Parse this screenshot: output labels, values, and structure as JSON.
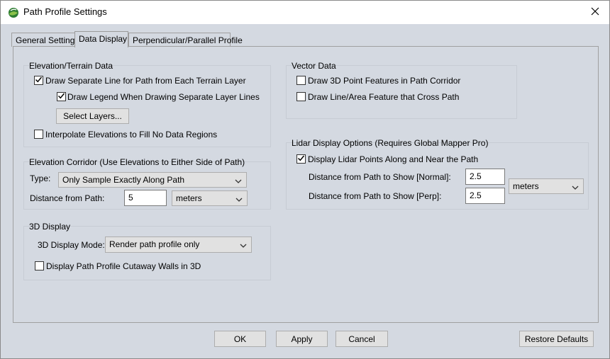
{
  "window": {
    "title": "Path Profile Settings"
  },
  "tabs": [
    {
      "label": "General Settings"
    },
    {
      "label": "Data Display"
    },
    {
      "label": "Perpendicular/Parallel Profile"
    }
  ],
  "elevation_terrain": {
    "title": "Elevation/Terrain Data",
    "draw_separate_line": {
      "label": "Draw Separate Line for Path from Each Terrain Layer",
      "checked": true
    },
    "draw_legend": {
      "label": "Draw Legend When Drawing Separate Layer Lines",
      "checked": true
    },
    "select_layers_label": "Select Layers...",
    "interpolate": {
      "label": "Interpolate Elevations to Fill No Data Regions",
      "checked": false
    }
  },
  "elevation_corridor": {
    "title": "Elevation Corridor (Use Elevations to Either Side of Path)",
    "type_label": "Type:",
    "type_value": "Only Sample Exactly Along Path",
    "distance_label": "Distance from Path:",
    "distance_value": "5",
    "distance_unit": "meters"
  },
  "display_3d": {
    "title": "3D Display",
    "mode_label": "3D Display Mode:",
    "mode_value": "Render path profile only",
    "cutaway": {
      "label": "Display Path Profile Cutaway Walls in 3D",
      "checked": false
    }
  },
  "vector_data": {
    "title": "Vector Data",
    "point_features": {
      "label": "Draw 3D Point Features in Path Corridor",
      "checked": false
    },
    "line_area": {
      "label": "Draw Line/Area Feature that Cross Path",
      "checked": false
    }
  },
  "lidar": {
    "title": "Lidar Display Options (Requires Global Mapper Pro)",
    "display_points": {
      "label": "Display Lidar Points Along and Near the Path",
      "checked": true
    },
    "normal_label": "Distance from Path to Show [Normal]:",
    "normal_value": "2.5",
    "perp_label": "Distance from Path to Show [Perp]:",
    "perp_value": "2.5",
    "unit": "meters"
  },
  "footer": {
    "ok_label": "OK",
    "apply_label": "Apply",
    "cancel_label": "Cancel",
    "restore_label": "Restore Defaults"
  },
  "icons": {
    "app": "globe-mapper-icon",
    "close": "close-icon",
    "check": "checkmark-icon",
    "dropdown": "chevron-down-icon"
  }
}
